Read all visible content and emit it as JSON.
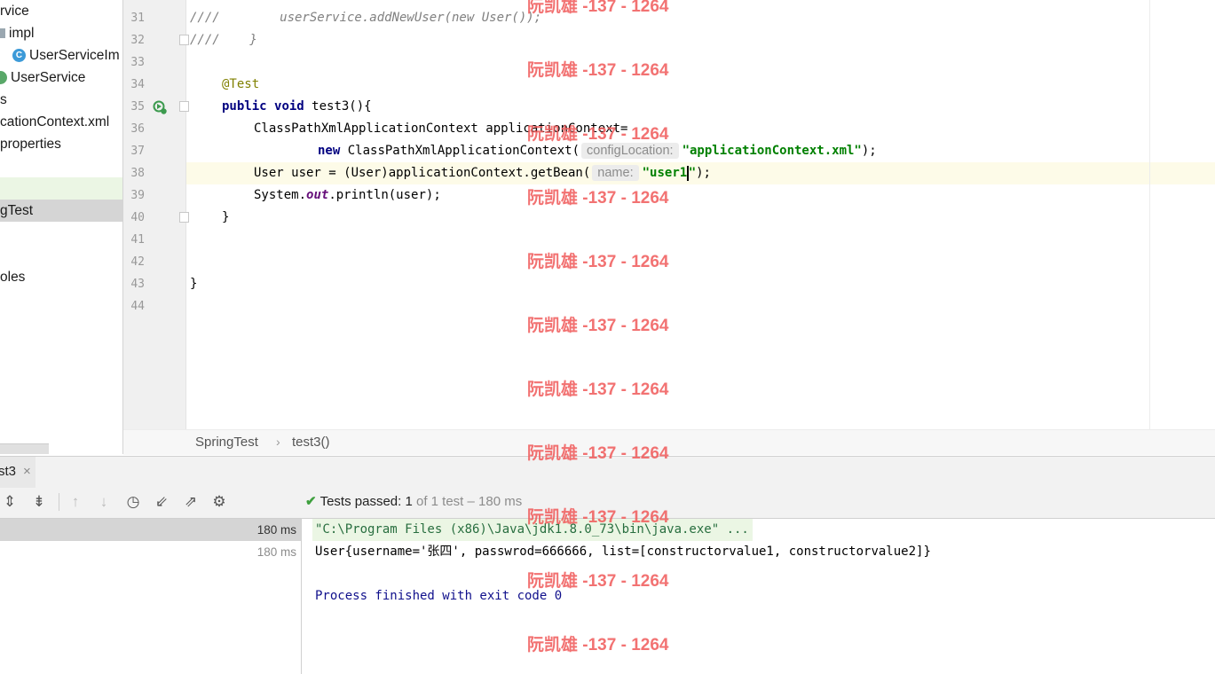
{
  "project_tree": {
    "items": [
      {
        "label": "rvice",
        "icon": "none"
      },
      {
        "label": "impl",
        "icon": "folder-icon"
      },
      {
        "label": "UserServiceIm",
        "icon": "class-icon",
        "icon_glyph": "C"
      },
      {
        "label": "UserService",
        "icon": "interface-icon"
      },
      {
        "label": "s",
        "icon": "none"
      },
      {
        "label": "cationContext.xml",
        "icon": "none"
      },
      {
        "label": "properties",
        "icon": "none"
      },
      {
        "label": "gTest",
        "icon": "none",
        "selected": true
      },
      {
        "label": "oles",
        "icon": "none"
      }
    ]
  },
  "editor": {
    "line_numbers": [
      "31",
      "32",
      "33",
      "34",
      "35",
      "36",
      "37",
      "38",
      "39",
      "40",
      "41",
      "42",
      "43",
      "44"
    ],
    "lines": {
      "l31_comment": "////        userService.addNewUser(new User());",
      "l32_comment": "////    }",
      "l34_annotation": "@Test",
      "l35_kw1": "public",
      "l35_kw2": "void",
      "l35_rest": " test3(){",
      "l36": "ClassPathXmlApplicationContext applicationContext=",
      "l37_kw": "new",
      "l37_rest": " ClassPathXmlApplicationContext(",
      "l37_hint": "configLocation:",
      "l37_str": "\"applicationContext.xml\"",
      "l37_end": ");",
      "l38_start": "User user = (User)applicationContext.getBean(",
      "l38_hint": "name:",
      "l38_str_a": "\"user1",
      "l38_str_b": "\"",
      "l38_end": ");",
      "l39_a": "System.",
      "l39_field": "out",
      "l39_b": ".println(user);",
      "l40": "}",
      "l43": "}"
    }
  },
  "breadcrumb": {
    "items": [
      "SpringTest",
      "test3()"
    ],
    "separator": "›"
  },
  "run_panel": {
    "tab_label": "st3",
    "tab_close": "×",
    "status_label": "Tests passed:",
    "status_count": "1",
    "status_detail": "of 1 test – 180 ms",
    "test_rows": [
      {
        "duration": "180 ms",
        "selected": true
      },
      {
        "duration": "180 ms",
        "selected": false
      }
    ],
    "console": [
      "\"C:\\Program Files (x86)\\Java\\jdk1.8.0_73\\bin\\java.exe\" ...",
      "User{username='张四', passwrod=666666, list=[constructorvalue1, constructorvalue2]}",
      "",
      "Process finished with exit code 0"
    ]
  },
  "watermark": "阮凯雄 -137 - 1264",
  "colors": {
    "keyword": "#000080",
    "string": "#008000",
    "annotation": "#808000",
    "comment": "#808080",
    "watermark": "#f05a5a",
    "pass": "#3fa03f"
  }
}
